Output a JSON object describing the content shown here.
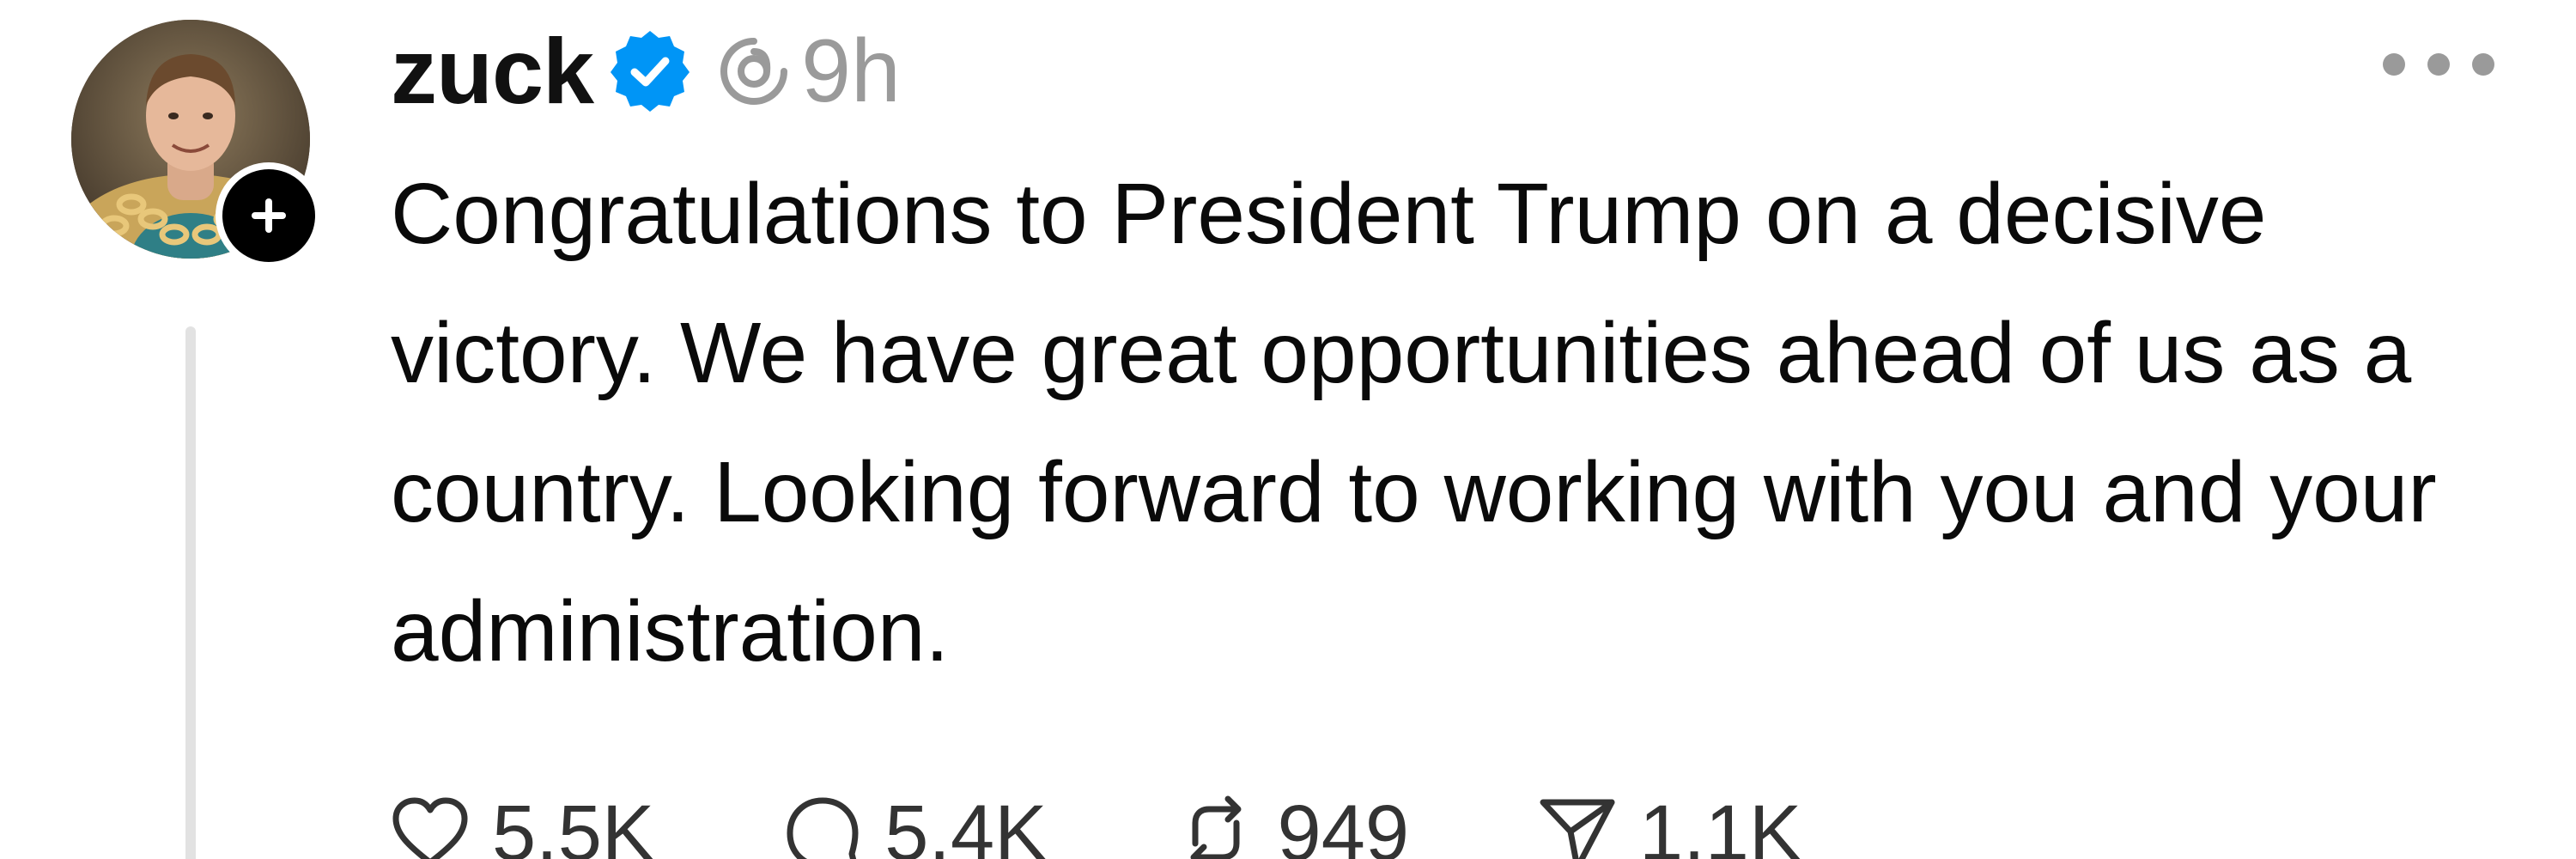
{
  "post": {
    "author": {
      "username": "zuck",
      "verified": true,
      "avatar_icon": "profile-photo"
    },
    "timestamp": "9h",
    "text": "Congratulations to President Trump on a decisive victory. We have great opportunities ahead of us as a country. Looking forward to working with you and your administration.",
    "actions": {
      "likes": "5.5K",
      "replies": "5.4K",
      "reposts": "949",
      "shares": "1.1K"
    }
  },
  "colors": {
    "verified_blue": "#0095f6",
    "muted_gray": "#9a9a9a",
    "thread_line": "#e2e2e2",
    "text": "#0a0a0a"
  },
  "icons": {
    "verified": "verified-badge-icon",
    "threads": "threads-logo-icon",
    "more": "more-options-icon",
    "follow": "plus-icon",
    "like": "heart-icon",
    "reply": "comment-bubble-icon",
    "repost": "repost-icon",
    "share": "paper-plane-icon"
  }
}
